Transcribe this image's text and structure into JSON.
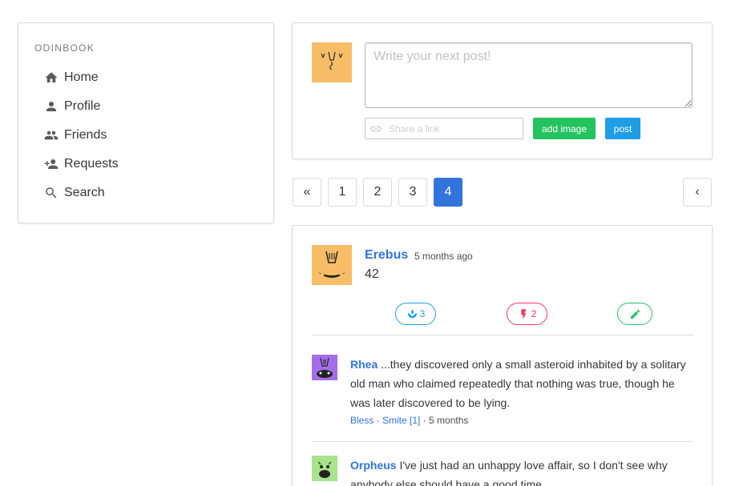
{
  "sidebar": {
    "brand": "ODINBOOK",
    "items": [
      {
        "label": "Home",
        "icon": "home-icon"
      },
      {
        "label": "Profile",
        "icon": "person-icon"
      },
      {
        "label": "Friends",
        "icon": "people-icon"
      },
      {
        "label": "Requests",
        "icon": "person-add-icon"
      },
      {
        "label": "Search",
        "icon": "search-icon"
      }
    ]
  },
  "composer": {
    "placeholder": "Write your next post!",
    "link_placeholder": "Share a link",
    "add_image_label": "add image",
    "post_label": "post"
  },
  "pagination": {
    "first": "«",
    "pages": [
      "1",
      "2",
      "3",
      "4"
    ],
    "current": "4",
    "prev": "‹"
  },
  "post": {
    "author": "Erebus",
    "time": "5 months ago",
    "body": "42",
    "bless_count": "3",
    "smite_count": "2",
    "colors": {
      "bless": "#1f9ee8",
      "smite": "#ee3860",
      "edit": "#23c35f"
    }
  },
  "comments": [
    {
      "author": "Rhea",
      "text": "...they discovered only a small asteroid inhabited by a solitary old man who claimed repeatedly that nothing was true, though he was later discovered to be lying.",
      "bless": "Bless",
      "smite": "Smite [1]",
      "time": "5 months",
      "avatar_color": "#a46ee8"
    },
    {
      "author": "Orpheus",
      "text": "I've just had an unhappy love affair, so I don't see why anybody else should have a good time.",
      "avatar_color": "#a8e48c"
    }
  ],
  "colors": {
    "accent": "#3273dc",
    "avatar_orange": "#f7bd67"
  }
}
